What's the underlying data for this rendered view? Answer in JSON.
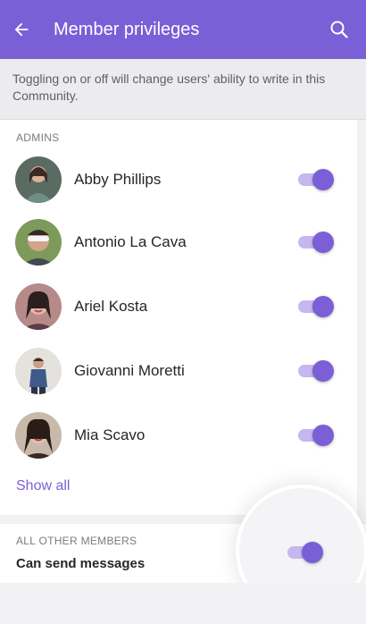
{
  "header": {
    "title": "Member privileges",
    "background": "#7b5fd6",
    "back_icon": "arrow-left-icon",
    "search_icon": "search-icon"
  },
  "info_text": "Toggling on or off will change users' ability to write in this Community.",
  "admins": {
    "header": "ADMINS",
    "members": [
      {
        "name": "Abby Phillips",
        "enabled": true
      },
      {
        "name": "Antonio La Cava",
        "enabled": true
      },
      {
        "name": "Ariel Kosta",
        "enabled": true
      },
      {
        "name": "Giovanni Moretti",
        "enabled": true
      },
      {
        "name": "Mia Scavo",
        "enabled": true
      }
    ],
    "show_all_label": "Show all"
  },
  "others": {
    "header": "ALL OTHER MEMBERS",
    "label": "Can send messages",
    "enabled": true
  },
  "colors": {
    "accent": "#7b5fd6",
    "toggle_track": "#c5b7ef"
  }
}
